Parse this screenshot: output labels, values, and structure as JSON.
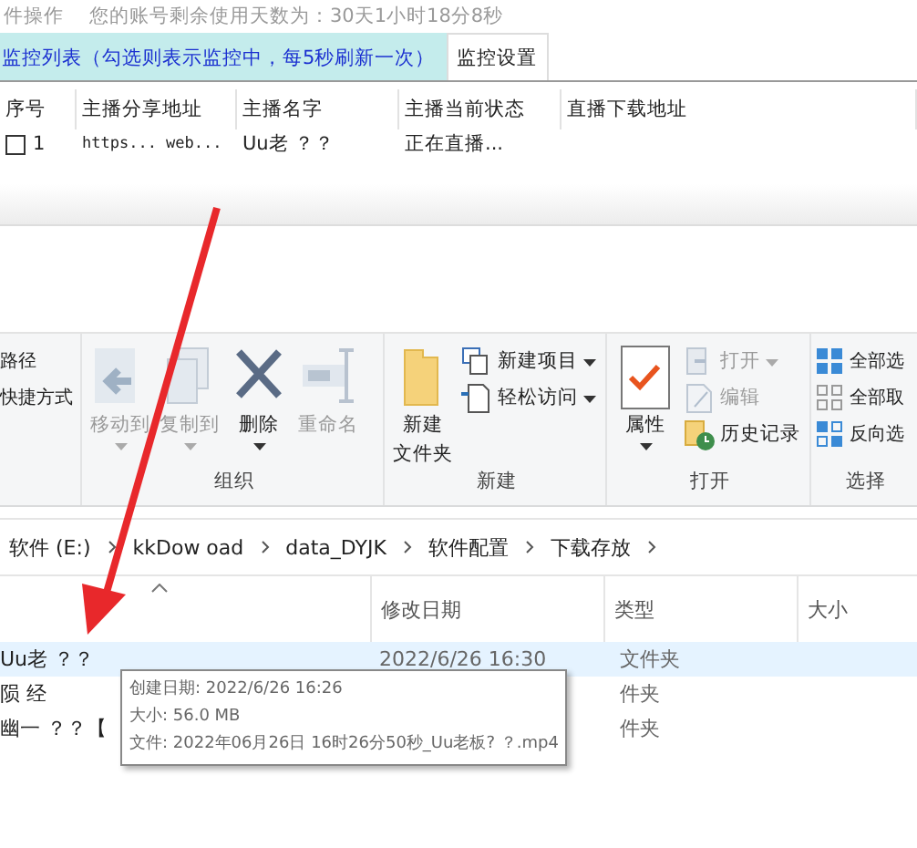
{
  "app": {
    "menu": "件操作",
    "account": "您的账号剩余使用天数为：30天1小时18分8秒",
    "tabs": [
      {
        "label": "监控列表（勾选则表示监控中，每5秒刷新一次）",
        "selected": true
      },
      {
        "label": "监控设置",
        "selected": false
      }
    ],
    "columns": [
      "序号",
      "主播分享地址",
      "主播名字",
      "主播当前状态",
      "直播下载地址"
    ],
    "rows": [
      {
        "checked": false,
        "cells": [
          "1",
          "https... web...",
          "Uu老 ？？",
          "正在直播..."
        ]
      }
    ]
  },
  "explorer": {
    "ribbon_groups": [
      {
        "items": [
          {
            "kind": "small",
            "label": "路径",
            "disabled": false,
            "menu": false
          },
          {
            "kind": "small",
            "label": "快捷方式",
            "disabled": false,
            "menu": false
          }
        ]
      },
      {
        "label": "组织",
        "items": [
          {
            "kind": "large",
            "label": "移动到",
            "disabled": true,
            "menu": true
          },
          {
            "kind": "large",
            "label": "复制到",
            "disabled": true,
            "menu": true
          },
          {
            "kind": "large",
            "label": "删除",
            "disabled": false,
            "menu": true
          },
          {
            "kind": "large",
            "label": "重命名",
            "disabled": true,
            "menu": false
          }
        ]
      },
      {
        "label": "新建",
        "items": [
          {
            "kind": "large",
            "lines": [
              "新建",
              "文件夹"
            ],
            "disabled": false,
            "menu": false
          },
          {
            "kind": "small",
            "label": "新建项目",
            "disabled": false,
            "menu": true
          },
          {
            "kind": "small",
            "label": "轻松访问",
            "disabled": false,
            "menu": true
          }
        ]
      },
      {
        "label": "打开",
        "items": [
          {
            "kind": "large",
            "label": "属性",
            "disabled": false,
            "menu": true
          },
          {
            "kind": "small",
            "label": "打开",
            "disabled": true,
            "menu": true
          },
          {
            "kind": "small",
            "label": "编辑",
            "disabled": true,
            "menu": false
          },
          {
            "kind": "small",
            "label": "历史记录",
            "disabled": false,
            "menu": false
          }
        ]
      },
      {
        "label": "选择",
        "items": [
          {
            "kind": "small",
            "label": "全部选",
            "disabled": false,
            "menu": false
          },
          {
            "kind": "small",
            "label": "全部取",
            "disabled": false,
            "menu": false
          },
          {
            "kind": "small",
            "label": "反向选",
            "disabled": false,
            "menu": false
          }
        ]
      }
    ],
    "breadcrumb": [
      "软件 (E:)",
      "kkDow oad",
      "data_DYJK",
      "软件配置",
      "下载存放"
    ],
    "columns": [
      "修改日期",
      "类型",
      "大小"
    ],
    "files": [
      {
        "name": "Uu老 ？？",
        "date": "2022/6/26 16:30",
        "type": "文件夹",
        "selected": true
      },
      {
        "name": "陨 经",
        "type": "件夹",
        "selected": false
      },
      {
        "name": "幽一 ？？【",
        "type": "件夹",
        "selected": false
      }
    ],
    "tooltip": [
      "创建日期: 2022/6/26 16:26",
      "大小: 56.0 MB",
      "文件: 2022年06月26日 16时26分50秒_Uu老板? ？.mp4"
    ]
  }
}
